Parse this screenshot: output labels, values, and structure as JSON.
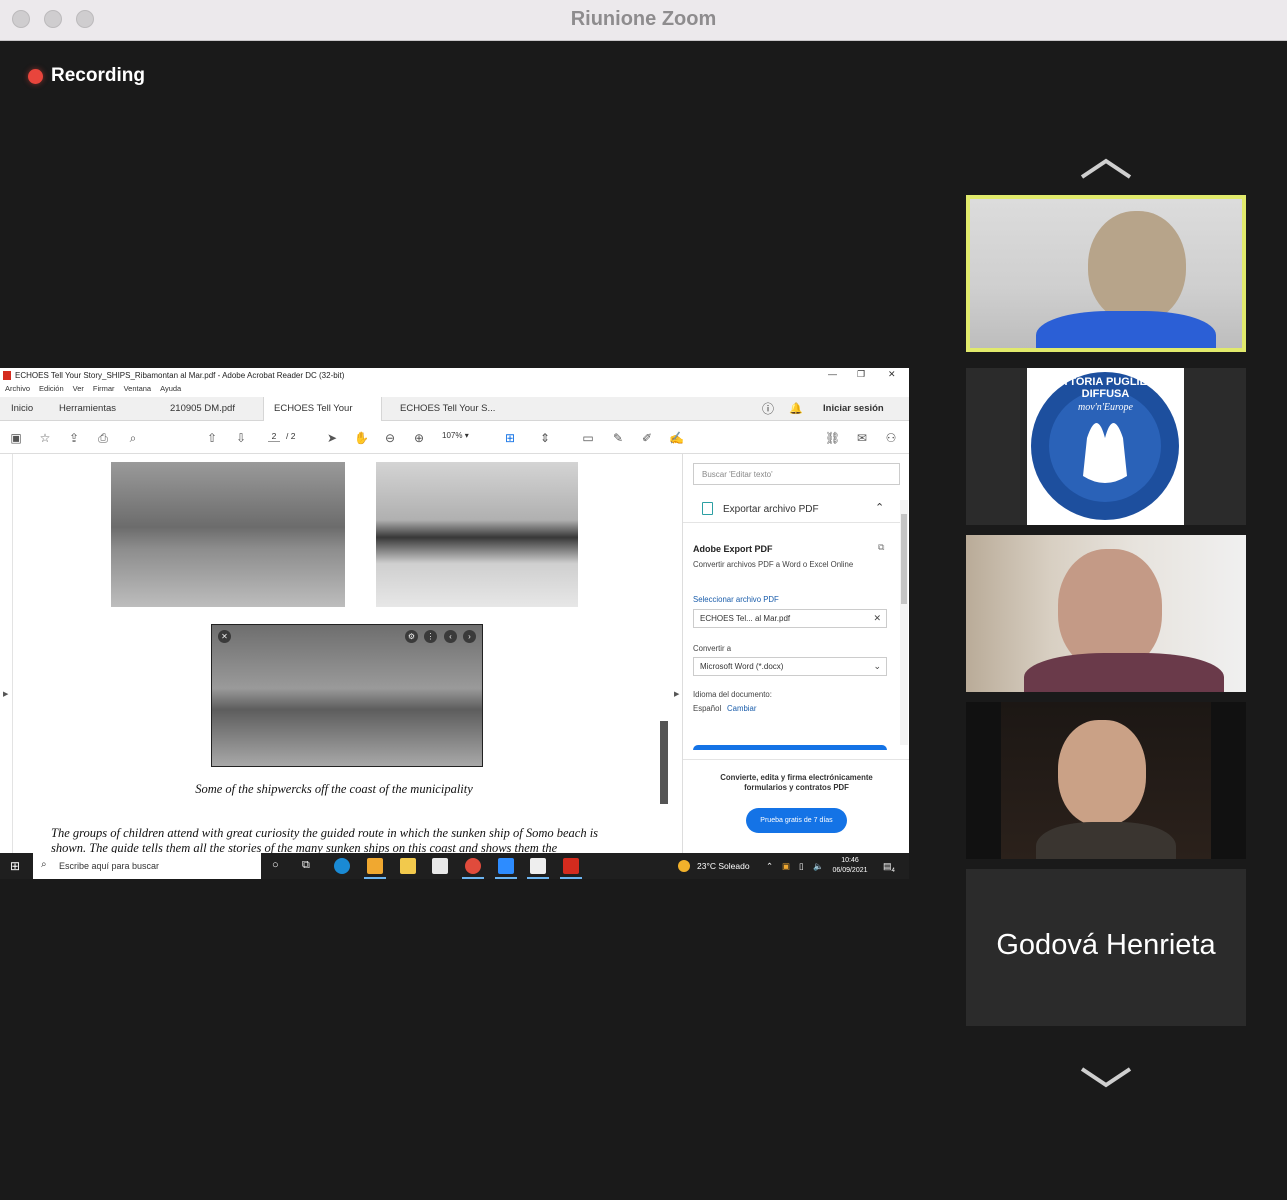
{
  "window": {
    "title": "Riunione Zoom"
  },
  "recording": {
    "label": "Recording"
  },
  "acrobat": {
    "title": "ECHOES Tell Your Story_SHIPS_Ribamontan al Mar.pdf - Adobe Acrobat Reader DC (32-bit)",
    "menu": [
      "Archivo",
      "Edición",
      "Ver",
      "Firmar",
      "Ventana",
      "Ayuda"
    ],
    "tabs": [
      "Inicio",
      "Herramientas",
      "210905 DM.pdf",
      "ECHOES Tell Your S...",
      "ECHOES Tell Your S..."
    ],
    "signin": "Iniciar sesión",
    "page_current": "2",
    "page_total": "/ 2",
    "zoom": "107%",
    "caption": "Some of the shipwercks off the coast of the municipality",
    "body_text": "The groups of children attend with great curiosity the guided route in which the sunken ship of Somo beach is shown. The guide tells them all the stories of the many sunken ships on this coast and shows them the",
    "panel": {
      "search_placeholder": "Buscar 'Editar texto'",
      "export_label": "Exportar archivo PDF",
      "service_title": "Adobe Export PDF",
      "service_desc": "Convertir archivos PDF a Word o Excel Online",
      "select_label": "Seleccionar archivo PDF",
      "file_value": "ECHOES Tel... al Mar.pdf",
      "convert_label": "Convertir a",
      "format_value": "Microsoft Word (*.docx)",
      "lang_label": "Idioma del documento:",
      "lang_value": "Español",
      "lang_change": "Cambiar",
      "promo": "Convierte, edita y firma electrónicamente formularios y contratos PDF",
      "trial_button": "Prueba gratis de 7 días"
    }
  },
  "taskbar": {
    "search_placeholder": "Escribe aquí para buscar",
    "weather": "23°C  Soleado",
    "time": "10:46",
    "date": "06/09/2021",
    "notif_count": "4"
  },
  "participants": {
    "tiles": [
      "video-participant-1",
      "logo-participant",
      "video-participant-3",
      "video-participant-4"
    ],
    "name_tile": "Godová Henrieta",
    "logo_text_top": "FATTORIA PUGLIESE DIFFUSA",
    "logo_text_mid": "mov'n'Europe"
  },
  "colors": {
    "active_speaker": "#e1ea6c",
    "recording": "#e8453c",
    "acrobat_blue": "#1473e6"
  }
}
